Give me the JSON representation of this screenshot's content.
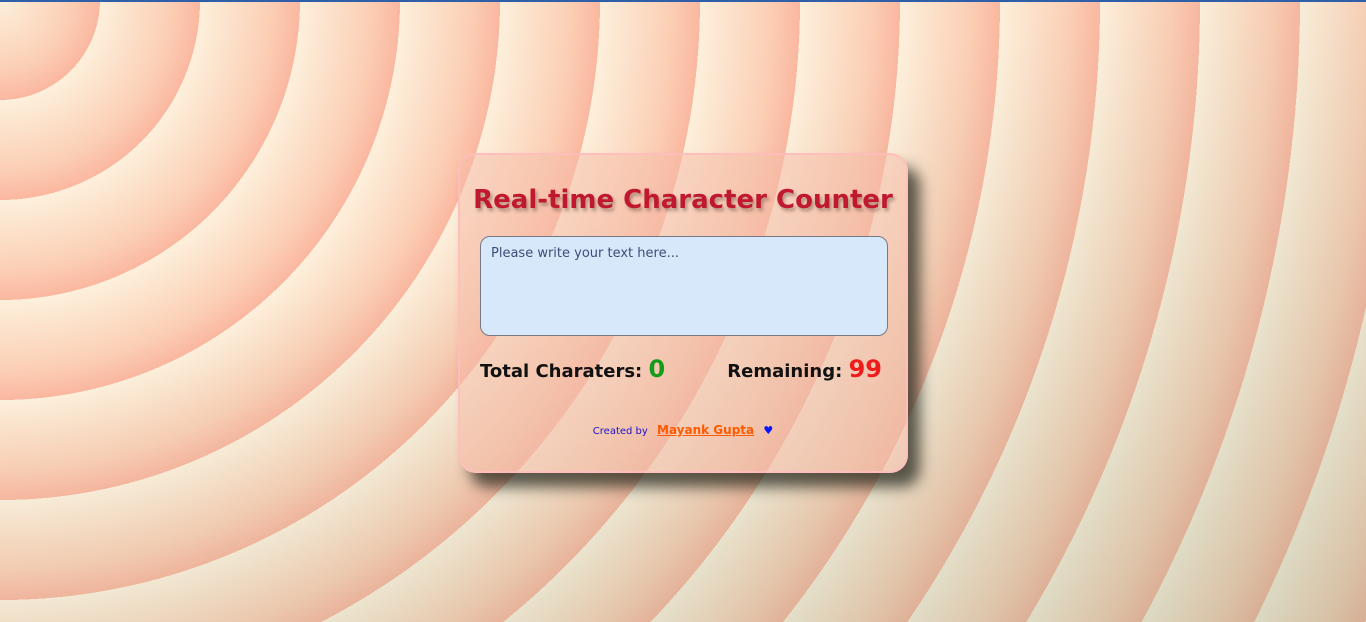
{
  "page": {
    "title": "Real-time Character Counter"
  },
  "input": {
    "placeholder": "Please write your text here...",
    "value": ""
  },
  "stats": {
    "total_label": "Total Charaters:",
    "total_value": "0",
    "remaining_label": "Remaining:",
    "remaining_value": "99"
  },
  "footer": {
    "created_by": "Created by",
    "author": "Mayank Gupta",
    "heart_icon": "heart-icon"
  },
  "colors": {
    "title": "#c0182f",
    "total_value": "#139b1c",
    "remaining_value": "#ee1c1c",
    "author_link": "#ff5a00",
    "created_by": "#1a12c8",
    "textarea_bg": "#d8e8fb"
  }
}
